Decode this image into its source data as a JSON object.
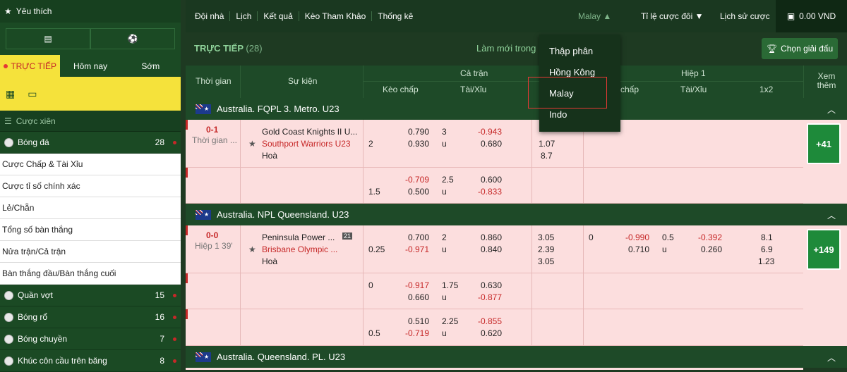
{
  "sidebar": {
    "favorites": "Yêu thích",
    "tabs": [
      "TRỰC TIẾP",
      "Hôm nay",
      "Sớm"
    ],
    "parlay": "Cược xiên",
    "sports_top": {
      "name": "Bóng đá",
      "count": "28"
    },
    "sub_items": [
      "Cược Chấp & Tài Xỉu",
      "Cược tỉ số chính xác",
      "Lẻ/Chẵn",
      "Tổng số bàn thắng",
      "Nửa trận/Cả trận",
      "Bàn thắng đầu/Bàn thắng cuối"
    ],
    "sports": [
      {
        "name": "Quần vợt",
        "count": "15"
      },
      {
        "name": "Bóng rổ",
        "count": "16"
      },
      {
        "name": "Bóng chuyền",
        "count": "7"
      },
      {
        "name": "Khúc côn cầu trên băng",
        "count": "8"
      }
    ]
  },
  "nav": {
    "items": [
      "Đội nhà",
      "Lịch",
      "Kết quả",
      "Kèo Tham Khảo",
      "Thống kê"
    ],
    "odds_selector": "Malay",
    "ratio": "Tỉ lệ cược đôi",
    "history": "Lịch sử cược",
    "wallet": "0.00 VND"
  },
  "toolbar": {
    "live_title": "TRỰC TIẾP",
    "live_count": "(28)",
    "refresh": "Làm mới trong",
    "choose_league": "Chọn giải đấu"
  },
  "table_header": {
    "time": "Thời gian",
    "event": "Sự kiện",
    "full_match": "Cả trận",
    "handicap": "Kèo chấp",
    "over_under": "Tài/Xỉu",
    "half1": "Hiệp 1",
    "handicap_short": "chấp",
    "over_under2": "Tài/Xỉu",
    "x12": "1x2",
    "more": "Xem thêm"
  },
  "dropdown": {
    "options": [
      "Thập phân",
      "Hồng Kông",
      "Malay",
      "Indo"
    ],
    "selected": "Malay"
  },
  "leagues": [
    {
      "name": "Australia. FQPL 3. Metro. U23",
      "match": {
        "score": "0-1",
        "time": "Thời gian ...",
        "home": "Gold Coast Knights II U...",
        "away": "Southport Warriors U23",
        "draw": "Hoà",
        "more": "+41",
        "line1": {
          "hdp": "2",
          "home_odds": "0.790",
          "away_odds": "0.930",
          "ou": "3",
          "u": "u",
          "over": "-0.943",
          "under": "0.680",
          "x1": "",
          "x2": "1.07",
          "x3": "8.7"
        },
        "line2": {
          "hdp": "1.5",
          "home_odds": "-0.709",
          "away_odds": "0.500",
          "ou": "2.5",
          "u": "u",
          "over": "0.600",
          "under": "-0.833"
        }
      }
    },
    {
      "name": "Australia. NPL Queensland. U23",
      "match": {
        "score": "0-0",
        "time": "Hiệp 1 39'",
        "home": "Peninsula Power ...",
        "away": "Brisbane Olympic ...",
        "draw": "Hoà",
        "more": "+149",
        "line1": {
          "hdp": "0.25",
          "home_odds": "0.700",
          "away_odds": "-0.971",
          "ou": "2",
          "u": "u",
          "over": "0.860",
          "under": "0.840",
          "x1": "3.05",
          "x2": "2.39",
          "x3": "3.05",
          "h1_hdp": "0",
          "h1_home": "-0.990",
          "h1_away": "0.710",
          "h1_ou": "0.5",
          "h1_u": "u",
          "h1_over": "-0.392",
          "h1_under": "0.260",
          "h1_x1": "8.1",
          "h1_x2": "6.9",
          "h1_x3": "1.23"
        },
        "line2": {
          "hdp": "0",
          "home_odds": "-0.917",
          "away_odds": "0.660",
          "ou": "1.75",
          "u": "u",
          "over": "0.630",
          "under": "-0.877"
        },
        "line3": {
          "hdp": "0.5",
          "home_odds": "0.510",
          "away_odds": "-0.719",
          "ou": "2.25",
          "u": "u",
          "over": "-0.855",
          "under": "0.620"
        }
      }
    },
    {
      "name": "Australia. Queensland. PL. U23"
    }
  ]
}
